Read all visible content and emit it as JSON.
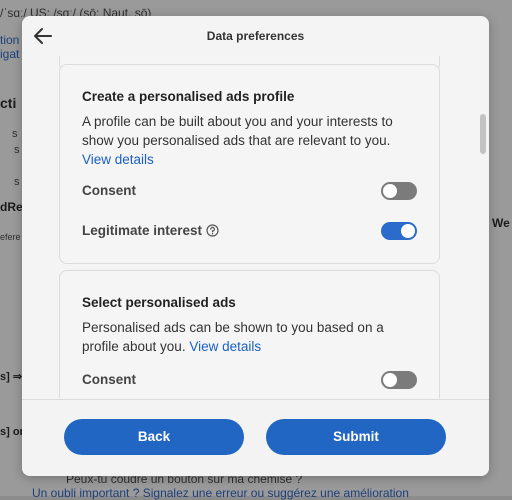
{
  "background": {
    "texts": [
      "/ˈsɑː/  US:  /sɑː/  (sō: Naut, sō)",
      "tion",
      "igat",
      "cti",
      "s",
      "s",
      "s",
      "dRe",
      "efere",
      "We",
      "s] ⇒",
      "s] or",
      "Peux-tu coudre un bouton sur ma chemise ?",
      "Un oubli important ? Signalez une erreur ou suggérez une amélioration"
    ]
  },
  "modal": {
    "title": "Data preferences",
    "back_icon": "arrow-left-icon",
    "cards": [
      {
        "title": "Create a personalised ads profile",
        "description": "A profile can be built about you and your interests to show you personalised ads that are relevant to you.",
        "link": "View details",
        "rows": [
          {
            "label": "Consent",
            "state": "off"
          },
          {
            "label": "Legitimate interest",
            "state": "on",
            "icon": "help-circle-icon"
          }
        ]
      },
      {
        "title": "Select personalised ads",
        "description": "Personalised ads can be shown to you based on a profile about you.",
        "link": "View details",
        "rows": [
          {
            "label": "Consent",
            "state": "off"
          }
        ]
      }
    ],
    "buttons": {
      "back": "Back",
      "submit": "Submit"
    },
    "colors": {
      "accent": "#2266c4",
      "toggle_off": "#7b7b7b"
    }
  }
}
